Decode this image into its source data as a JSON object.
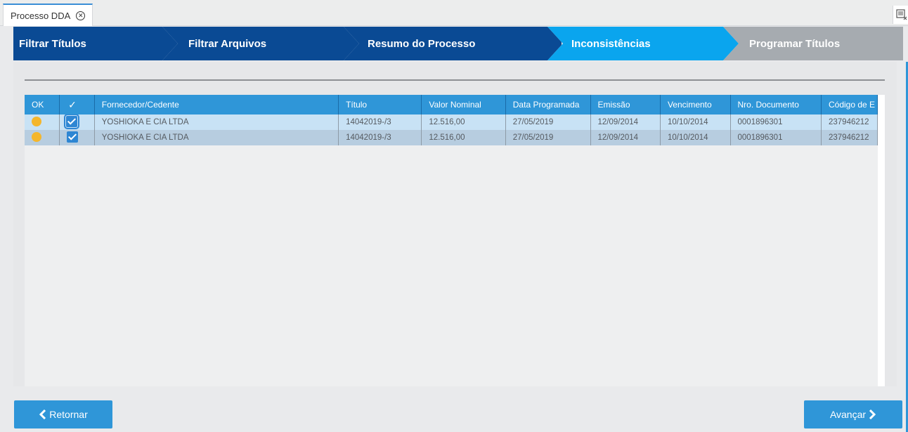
{
  "tab": {
    "title": "Processo DDA",
    "close_icon": "close-circle-icon"
  },
  "corner_icon": "window-restore-icon",
  "wizard": {
    "steps": [
      {
        "label": "Filtrar Títulos",
        "state": "done"
      },
      {
        "label": "Filtrar Arquivos",
        "state": "done"
      },
      {
        "label": "Resumo do Processo",
        "state": "done"
      },
      {
        "label": "Inconsistências",
        "state": "active"
      },
      {
        "label": "Programar Títulos",
        "state": "pending"
      }
    ],
    "colors": {
      "done": "#0a4a94",
      "active": "#0aa5ee",
      "pending": "#a6abb0"
    }
  },
  "table": {
    "columns": [
      "OK",
      "✓",
      "Fornecedor/Cedente",
      "Título",
      "Valor Nominal",
      "Data Programada",
      "Emissão",
      "Vencimento",
      "Nro. Documento",
      "Código de E"
    ],
    "rows": [
      {
        "status_color": "#f4b62c",
        "checked": true,
        "fornecedor": "YOSHIOKA E CIA LTDA",
        "titulo": "14042019-/3",
        "valor": "12.516,00",
        "data_programada": "27/05/2019",
        "emissao": "12/09/2014",
        "vencimento": "10/10/2014",
        "nro_documento": "0001896301",
        "codigo": "237946212"
      },
      {
        "status_color": "#f4b62c",
        "checked": true,
        "fornecedor": "YOSHIOKA E CIA LTDA",
        "titulo": "14042019-/3",
        "valor": "12.516,00",
        "data_programada": "27/05/2019",
        "emissao": "12/09/2014",
        "vencimento": "10/10/2014",
        "nro_documento": "0001896301",
        "codigo": "237946212"
      }
    ]
  },
  "footer": {
    "back_label": "Retornar",
    "next_label": "Avançar",
    "back_icon": "chevron-left-icon",
    "next_icon": "chevron-right-icon"
  }
}
